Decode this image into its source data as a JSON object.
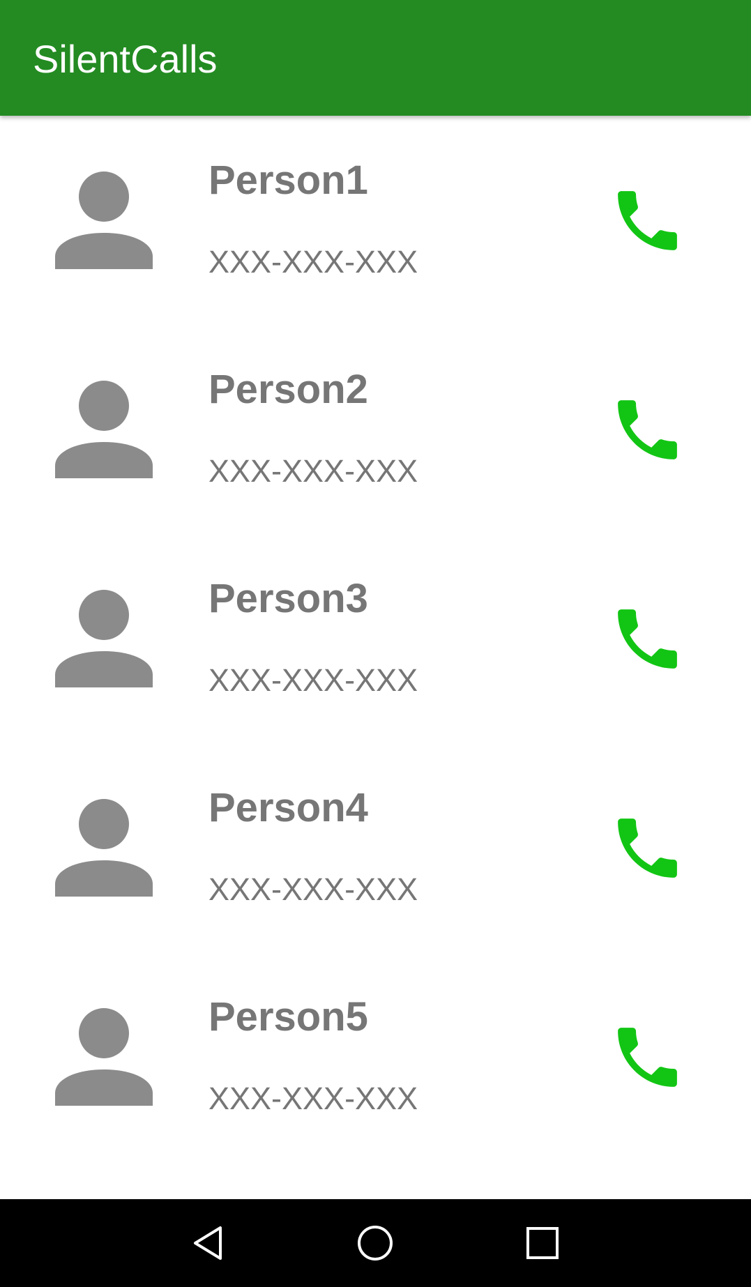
{
  "app": {
    "title": "SilentCalls"
  },
  "colors": {
    "app_bar": "#238b22",
    "avatar": "#8b8b8b",
    "call_icon": "#12c514",
    "contact_text": "#767676",
    "nav_bar": "#000000",
    "nav_icons": "#ffffff"
  },
  "contacts": [
    {
      "name": "Person1",
      "phone": "XXX-XXX-XXX",
      "avatar_icon": "person-icon",
      "action_icon": "phone-icon"
    },
    {
      "name": "Person2",
      "phone": "XXX-XXX-XXX",
      "avatar_icon": "person-icon",
      "action_icon": "phone-icon"
    },
    {
      "name": "Person3",
      "phone": "XXX-XXX-XXX",
      "avatar_icon": "person-icon",
      "action_icon": "phone-icon"
    },
    {
      "name": "Person4",
      "phone": "XXX-XXX-XXX",
      "avatar_icon": "person-icon",
      "action_icon": "phone-icon"
    },
    {
      "name": "Person5",
      "phone": "XXX-XXX-XXX",
      "avatar_icon": "person-icon",
      "action_icon": "phone-icon"
    }
  ],
  "nav_bar": {
    "buttons": [
      "back-icon",
      "home-icon",
      "recents-icon"
    ]
  }
}
